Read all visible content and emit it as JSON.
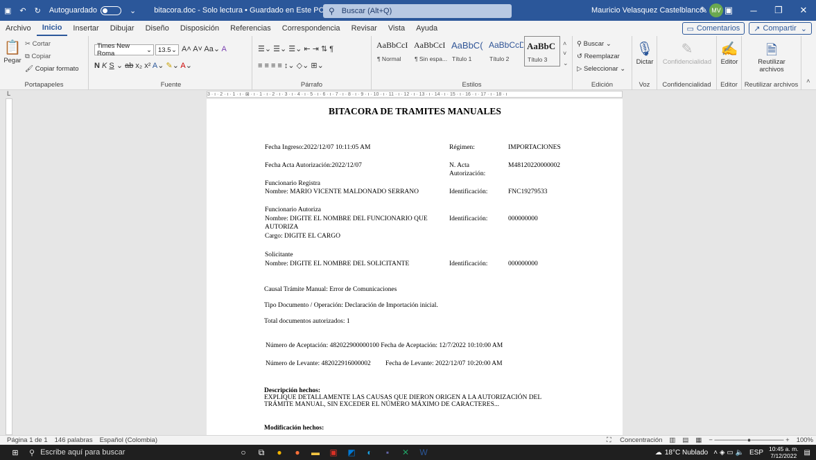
{
  "window": {
    "autosave_label": "Autoguardado",
    "doc_title": "bitacora.doc - Solo lectura • Guardado en Este PC",
    "search_placeholder": "Buscar (Alt+Q)",
    "user_name": "Mauricio Velasquez Castelblanco",
    "user_initials": "MV"
  },
  "tabs": [
    "Archivo",
    "Inicio",
    "Insertar",
    "Dibujar",
    "Diseño",
    "Disposición",
    "Referencias",
    "Correspondencia",
    "Revisar",
    "Vista",
    "Ayuda"
  ],
  "tab_right": {
    "comments": "Comentarios",
    "share": "Compartir"
  },
  "ribbon": {
    "clipboard": {
      "paste": "Pegar",
      "cut": "Cortar",
      "copy": "Copiar",
      "format_painter": "Copiar formato",
      "label": "Portapapeles"
    },
    "font": {
      "name": "Times New Roma",
      "size": "13.5",
      "label": "Fuente"
    },
    "paragraph": {
      "label": "Párrafo"
    },
    "styles": {
      "items": [
        {
          "sample": "AaBbCcI",
          "name": "¶ Normal"
        },
        {
          "sample": "AaBbCcI",
          "name": "¶ Sin espa..."
        },
        {
          "sample": "AaBbC(",
          "name": "Título 1"
        },
        {
          "sample": "AaBbCcD",
          "name": "Título 2"
        },
        {
          "sample": "AaBbC",
          "name": "Título 3"
        }
      ],
      "label": "Estilos"
    },
    "editing": {
      "find": "Buscar",
      "replace": "Reemplazar",
      "select": "Seleccionar",
      "label": "Edición"
    },
    "voice": {
      "dictate": "Dictar",
      "label": "Voz"
    },
    "sensitivity": {
      "btn": "Confidencialidad",
      "label": "Confidencialidad"
    },
    "editor": {
      "btn": "Editor",
      "label": "Editor"
    },
    "reuse": {
      "btn1": "Reutilizar",
      "btn2": "archivos",
      "label": "Reutilizar archivos"
    }
  },
  "ruler_text": "3 · ı · 2 · ı · 1 · ı · ⊠ · ı · 1 · ı · 2 · ı · 3 · ı · 4 · ı · 5 · ı · 6 · ı · 7 · ı · 8 · ı · 9 · ı · 10 · ı · 11 · ı · 12 · ı · 13 · ı · 14 · ı · 15 · ı · 16 · ı · 17 · ı · 18 · ı",
  "doc": {
    "title": "BITACORA DE TRAMITES MANUALES",
    "fecha_ingreso": "Fecha Ingreso:2022/12/07 10:11:05 AM",
    "regimen_label": "Régimen:",
    "regimen_value": "IMPORTACIONES",
    "fecha_acta": "Fecha Acta Autorización:2022/12/07",
    "n_acta_label_1": "N. Acta",
    "n_acta_label_2": "Autorización:",
    "n_acta_value": "M48120220000002",
    "func_registra": "Funcionario Registra",
    "nombre_registra": "Nombre: MARIO VICENTE MALDONADO SERRANO",
    "ident_label_1": "Identificación:",
    "ident_value_1": "FNC19279533",
    "func_autoriza": "Funcionario Autoriza",
    "nombre_autoriza_1": "Nombre: DIGITE EL NOMBRE DEL FUNCIONARIO QUE",
    "nombre_autoriza_2": "AUTORIZA",
    "ident_label_2": "Identificación:",
    "ident_value_2": "000000000",
    "cargo": "Cargo: DIGITE EL CARGO",
    "solicitante": "Solicitante",
    "nombre_solicitante": "Nombre: DIGITE EL NOMBRE DEL SOLICITANTE",
    "ident_label_3": "Identificación:",
    "ident_value_3": "000000000",
    "causal": "Causal Trámite Manual: Error de Comunicaciones",
    "tipo_doc": "Tipo Documento / Operación: Declaración de Importación inicial.",
    "total_docs": "Total documentos autorizados: 1",
    "num_aceptacion": "Número de Aceptación: 482022900000100 Fecha de Aceptación: 12/7/2022 10:10:00 AM",
    "num_levante": "Número de Levante: 482022916000002",
    "fecha_levante": "Fecha de Levante: 2022/12/07 10:20:00 AM",
    "desc_label": "Descripción hechos:",
    "desc_1": "EXPLIQUE DETALLAMENTE LAS CAUSAS QUE DIERON ORIGEN A LA AUTORIZACIÓN DEL",
    "desc_2": "TRÁMITE MANUAL, SIN EXCEDER EL NÚMERO MÁXIMO DE CARACTERES...",
    "mod_label": "Modificación hechos:"
  },
  "status": {
    "page": "Página 1 de 1",
    "words": "146 palabras",
    "lang": "Español (Colombia)",
    "focus": "Concentración",
    "zoom": "100%"
  },
  "taskbar": {
    "search": "Escribe aquí para buscar",
    "weather": "18°C Nublado",
    "lang": "ESP",
    "time": "10:45 a. m.",
    "date": "7/12/2022"
  }
}
